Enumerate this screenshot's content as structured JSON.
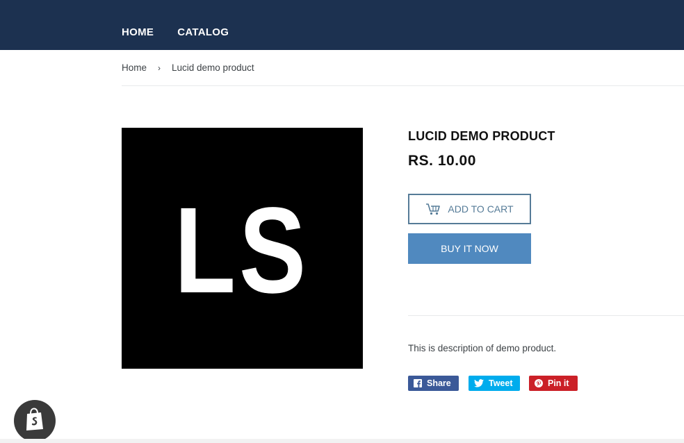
{
  "nav": {
    "items": [
      {
        "label": "HOME"
      },
      {
        "label": "CATALOG"
      }
    ]
  },
  "breadcrumb": {
    "home": "Home",
    "separator": "›",
    "current": "Lucid demo product"
  },
  "product": {
    "image_text": "LS",
    "title": "LUCID DEMO PRODUCT",
    "price": "RS. 10.00",
    "add_to_cart": "ADD TO CART",
    "buy_now": "BUY IT NOW",
    "description": "This is description of demo product."
  },
  "share": {
    "facebook": "Share",
    "twitter": "Tweet",
    "pinterest": "Pin it"
  },
  "icons": {
    "cart": "cart-icon",
    "facebook": "facebook-icon",
    "twitter": "twitter-icon",
    "pinterest": "pinterest-icon",
    "shopify": "shopify-bag-icon"
  },
  "colors": {
    "header_bg": "#1c3150",
    "accent": "#557b97",
    "buy_button": "#5089bf",
    "facebook": "#3b5998",
    "twitter": "#00aced",
    "pinterest": "#cb2027"
  }
}
